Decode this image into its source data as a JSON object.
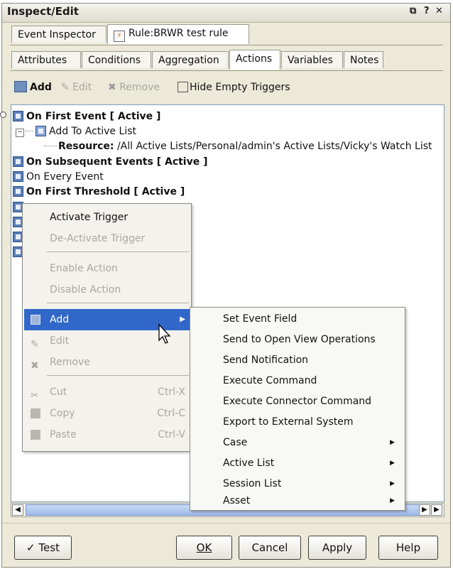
{
  "window": {
    "title": "Inspect/Edit",
    "controls": [
      "↗",
      "?",
      "×"
    ]
  },
  "tabs_top": [
    {
      "label": "Event Inspector",
      "active": false
    },
    {
      "label": "Rule:BRWR test rule",
      "active": true
    }
  ],
  "tabs_sub": [
    {
      "label": "Attributes",
      "active": false
    },
    {
      "label": "Conditions",
      "active": false
    },
    {
      "label": "Aggregation",
      "active": false
    },
    {
      "label": "Actions",
      "active": true
    },
    {
      "label": "Variables",
      "active": false
    },
    {
      "label": "Notes",
      "active": false
    }
  ],
  "toolbar": {
    "add": "Add",
    "edit": "Edit",
    "remove": "Remove",
    "hide_empty": "Hide Empty Triggers"
  },
  "tree": {
    "first_event": "On First Event [ Active ]",
    "add_to_active_list": "Add To Active List",
    "resource_label": "Resource:",
    "resource_value": " /All Active Lists/Personal/admin's Active Lists/Vicky's Watch List",
    "subsequent_events": "On Subsequent Events [ Active ]",
    "every_event": "On Every Event",
    "first_threshold": "On First Threshold [ Active ]"
  },
  "context_menu": {
    "activate_trigger": "Activate Trigger",
    "deactivate_trigger": "De-Activate Trigger",
    "enable_action": "Enable Action",
    "disable_action": "Disable Action",
    "add": "Add",
    "edit": "Edit",
    "remove": "Remove",
    "cut": "Cut",
    "cut_shortcut": "Ctrl-X",
    "copy": "Copy",
    "copy_shortcut": "Ctrl-C",
    "paste": "Paste",
    "paste_shortcut": "Ctrl-V"
  },
  "submenu": {
    "items": [
      {
        "label": "Set Event Field",
        "has_submenu": false
      },
      {
        "label": "Send to Open View Operations",
        "has_submenu": false
      },
      {
        "label": "Send Notification",
        "has_submenu": false
      },
      {
        "label": "Execute Command",
        "has_submenu": false
      },
      {
        "label": "Execute Connector Command",
        "has_submenu": false
      },
      {
        "label": "Export to External System",
        "has_submenu": false
      },
      {
        "label": "Case",
        "has_submenu": true
      },
      {
        "label": "Active List",
        "has_submenu": true
      },
      {
        "label": "Session List",
        "has_submenu": true
      },
      {
        "label": "Asset",
        "has_submenu": true
      }
    ]
  },
  "buttons": {
    "test": "Test",
    "ok": "OK",
    "cancel": "Cancel",
    "apply": "Apply",
    "help": "Help"
  },
  "colors": {
    "highlight": "#3167c8",
    "panel": "#ece9d8"
  }
}
